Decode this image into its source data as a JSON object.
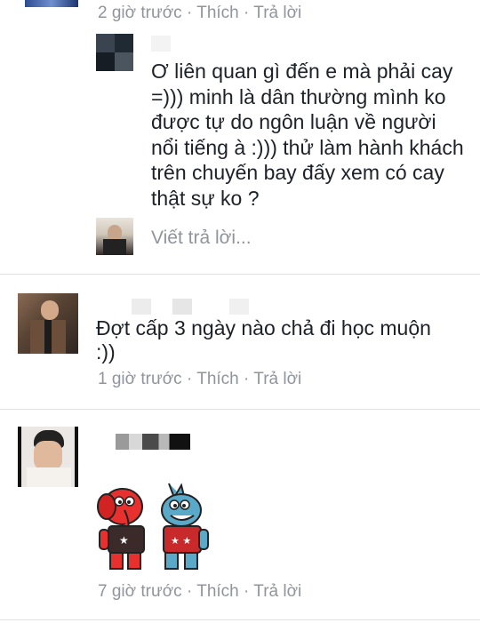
{
  "comments": [
    {
      "meta": {
        "time": "2 giờ trước",
        "sep1": " · ",
        "like": "Thích",
        "sep2": " · ",
        "reply": "Trả lời"
      }
    },
    {
      "text": "Ơ liên quan gì đến e mà phải cay =))) minh là dân thường mình ko được tự do ngôn luận về người nổi tiếng à :))) thử làm hành khách trên chuyến bay đấy xem có cay thật sự ko ?"
    },
    {
      "reply_placeholder": "Viết trả lời..."
    },
    {
      "text": "Đợt cấp 3 ngày nào chả đi học muộn :))",
      "meta": {
        "time": "1 giờ trước",
        "sep1": " · ",
        "like": "Thích",
        "sep2": " · ",
        "reply": "Trả lời"
      }
    },
    {
      "meta": {
        "time": "7 giờ trước",
        "sep1": " · ",
        "like": "Thích",
        "sep2": " · ",
        "reply": "Trả lời"
      }
    }
  ],
  "colors": {
    "meta": "#90949c",
    "text": "#1d2129",
    "divider": "#dddfe2"
  },
  "icons": [
    "avatar-photo",
    "sticker-cartoon-characters"
  ]
}
